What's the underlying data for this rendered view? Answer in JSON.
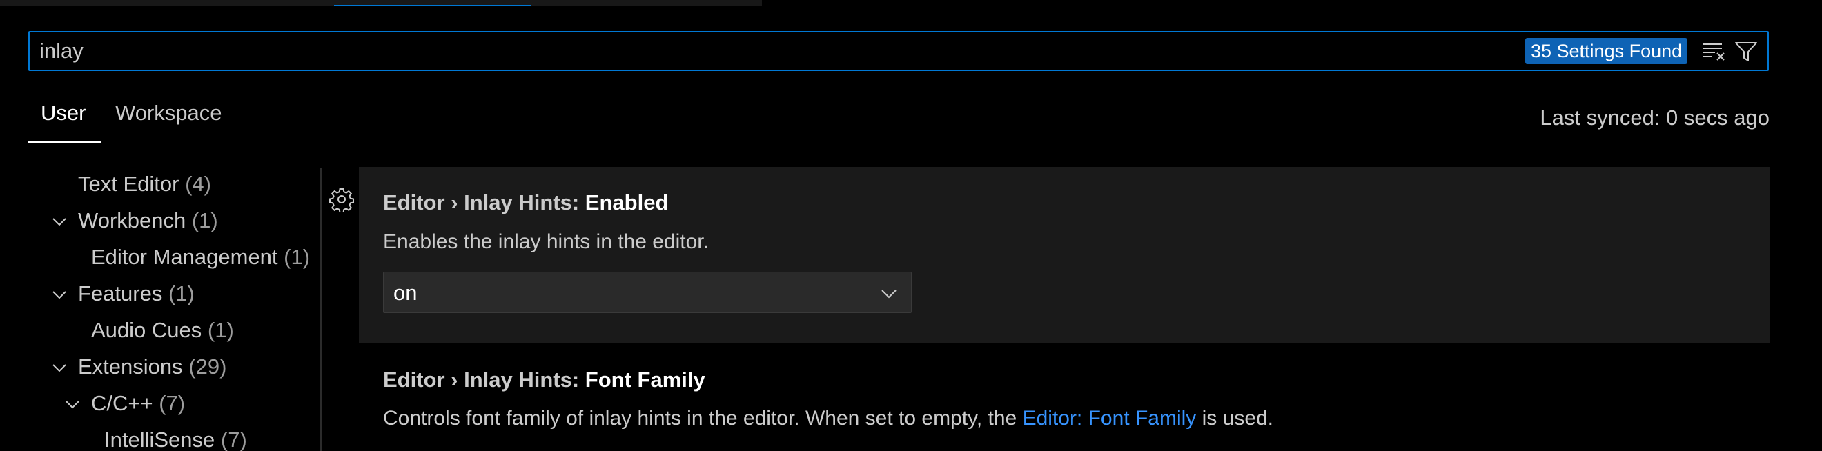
{
  "search": {
    "value": "inlay",
    "results_badge": "35 Settings Found"
  },
  "tabs": [
    {
      "label": "User",
      "active": true
    },
    {
      "label": "Workspace",
      "active": false
    }
  ],
  "sync_status": "Last synced: 0 secs ago",
  "toc": {
    "items": [
      {
        "label": "Text Editor",
        "count": "(4)"
      },
      {
        "label": "Workbench",
        "count": "(1)"
      },
      {
        "label": "Editor Management",
        "count": "(1)"
      },
      {
        "label": "Features",
        "count": "(1)"
      },
      {
        "label": "Audio Cues",
        "count": "(1)"
      },
      {
        "label": "Extensions",
        "count": "(29)"
      },
      {
        "label": "C/C++",
        "count": "(7)"
      },
      {
        "label": "IntelliSense",
        "count": "(7)"
      }
    ]
  },
  "settings": [
    {
      "category": "Editor › Inlay Hints: ",
      "name": "Enabled",
      "description": "Enables the inlay hints in the editor.",
      "value": "on"
    },
    {
      "category": "Editor › Inlay Hints: ",
      "name": "Font Family",
      "description_before": "Controls font family of inlay hints in the editor. When set to empty, the ",
      "description_link": "Editor: Font Family",
      "description_after": " is used."
    }
  ],
  "icons": {
    "clear": "clear-filter-icon",
    "filter": "filter-icon",
    "gear": "gear-icon",
    "chevron": "chevron-down-icon"
  },
  "colors": {
    "accent": "#0078d4",
    "badge": "#0e63b5",
    "link": "#3794ff",
    "focused_row": "#1a1a1a"
  }
}
